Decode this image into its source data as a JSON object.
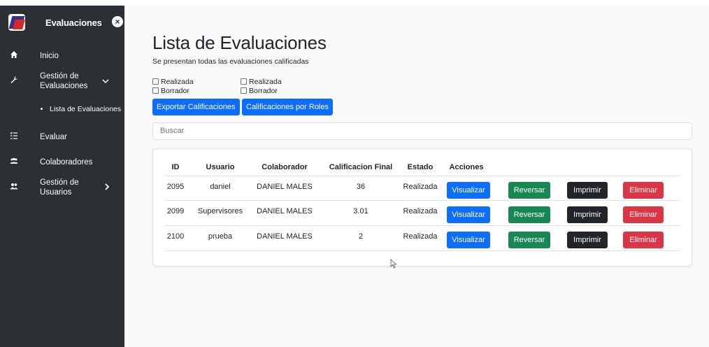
{
  "sidebar": {
    "title": "Evaluaciones",
    "close_icon": "close-icon",
    "items": [
      {
        "label": "Inicio",
        "icon": "home-icon"
      },
      {
        "label": "Gestión de Evaluaciones",
        "icon": "wrench-icon",
        "expanded": true
      },
      {
        "label": "Evaluar",
        "icon": "checklist-icon"
      },
      {
        "label": "Colaboradores",
        "icon": "users-icon"
      },
      {
        "label": "Gestión de Usuarios",
        "icon": "user-group-icon",
        "expanded": false
      }
    ],
    "subitems": [
      {
        "label": "Lista de Evaluaciones"
      }
    ]
  },
  "main": {
    "title": "Lista de Evaluaciones",
    "subtitle": "Se presentan todas las evaluaciones calificadas",
    "filters": {
      "col1": [
        "Realizada",
        "Borrador"
      ],
      "col2": [
        "Realizada",
        "Borrador"
      ]
    },
    "buttons": {
      "export": "Exportar Calificaciones",
      "roles": "Calificaciones por Roles"
    },
    "search_placeholder": "Buscar",
    "table": {
      "headers": [
        "ID",
        "Usuario",
        "Colaborador",
        "Calificacion Final",
        "Estado",
        "Acciones"
      ],
      "rows": [
        {
          "id": "2095",
          "usuario": "daniel",
          "colaborador": "DANIEL MALES",
          "calificacion": "36",
          "estado": "Realizada"
        },
        {
          "id": "2099",
          "usuario": "Supervisores",
          "colaborador": "DANIEL MALES",
          "calificacion": "3.01",
          "estado": "Realizada"
        },
        {
          "id": "2100",
          "usuario": "prueba",
          "colaborador": "DANIEL MALES",
          "calificacion": "2",
          "estado": "Realizada"
        }
      ],
      "actions": {
        "visualizar": "Visualizar",
        "reversar": "Reversar",
        "imprimir": "Imprimir",
        "eliminar": "Eliminar"
      }
    }
  },
  "colors": {
    "sidebar_bg": "#2b3035",
    "primary": "#0d6efd",
    "success": "#198754",
    "dark": "#212529",
    "danger": "#dc3545"
  }
}
